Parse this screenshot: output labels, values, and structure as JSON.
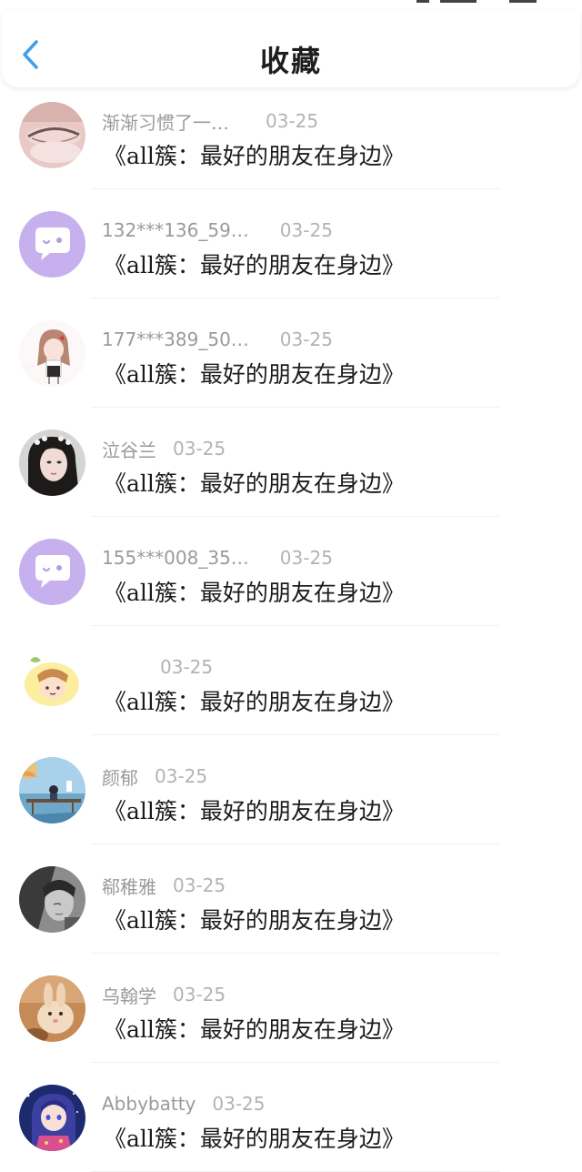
{
  "header": {
    "title": "收藏"
  },
  "colors": {
    "accent": "#3ea0e8",
    "name_text": "#9a9a9a",
    "date_text": "#b3b3b3",
    "title_text": "#1c1c1c"
  },
  "items": [
    {
      "user": "渐渐习惯了一…",
      "date": "03-25",
      "title": "《all簇：最好的朋友在身边》",
      "avatar": "eye-closeup-photo"
    },
    {
      "user": "132***136_59…",
      "date": "03-25",
      "title": "《all簇：最好的朋友在身边》",
      "avatar": "default-chat-bubble-avatar"
    },
    {
      "user": "177***389_50…",
      "date": "03-25",
      "title": "《all簇：最好的朋友在身边》",
      "avatar": "anime-girl-drawing"
    },
    {
      "user": "泣谷兰",
      "date": "03-25",
      "title": "《all簇：最好的朋友在身边》",
      "avatar": "girl-portrait-photo"
    },
    {
      "user": "155***008_35…",
      "date": "03-25",
      "title": "《all簇：最好的朋友在身边》",
      "avatar": "default-chat-bubble-avatar"
    },
    {
      "user": "",
      "date": "03-25",
      "title": "《all簇：最好的朋友在身边》",
      "avatar": "cartoon-boy-sticker"
    },
    {
      "user": "颜郁",
      "date": "03-25",
      "title": "《all簇：最好的朋友在身边》",
      "avatar": "anime-pier-scene"
    },
    {
      "user": "郗稚雅",
      "date": "03-25",
      "title": "《all簇：最好的朋友在身边》",
      "avatar": "bw-portrait-photo"
    },
    {
      "user": "乌翰学",
      "date": "03-25",
      "title": "《all簇：最好的朋友在身边》",
      "avatar": "rabbit-photo"
    },
    {
      "user": "Abbybatty",
      "date": "03-25",
      "title": "《all簇：最好的朋友在身边》",
      "avatar": "anime-night-girl"
    }
  ]
}
